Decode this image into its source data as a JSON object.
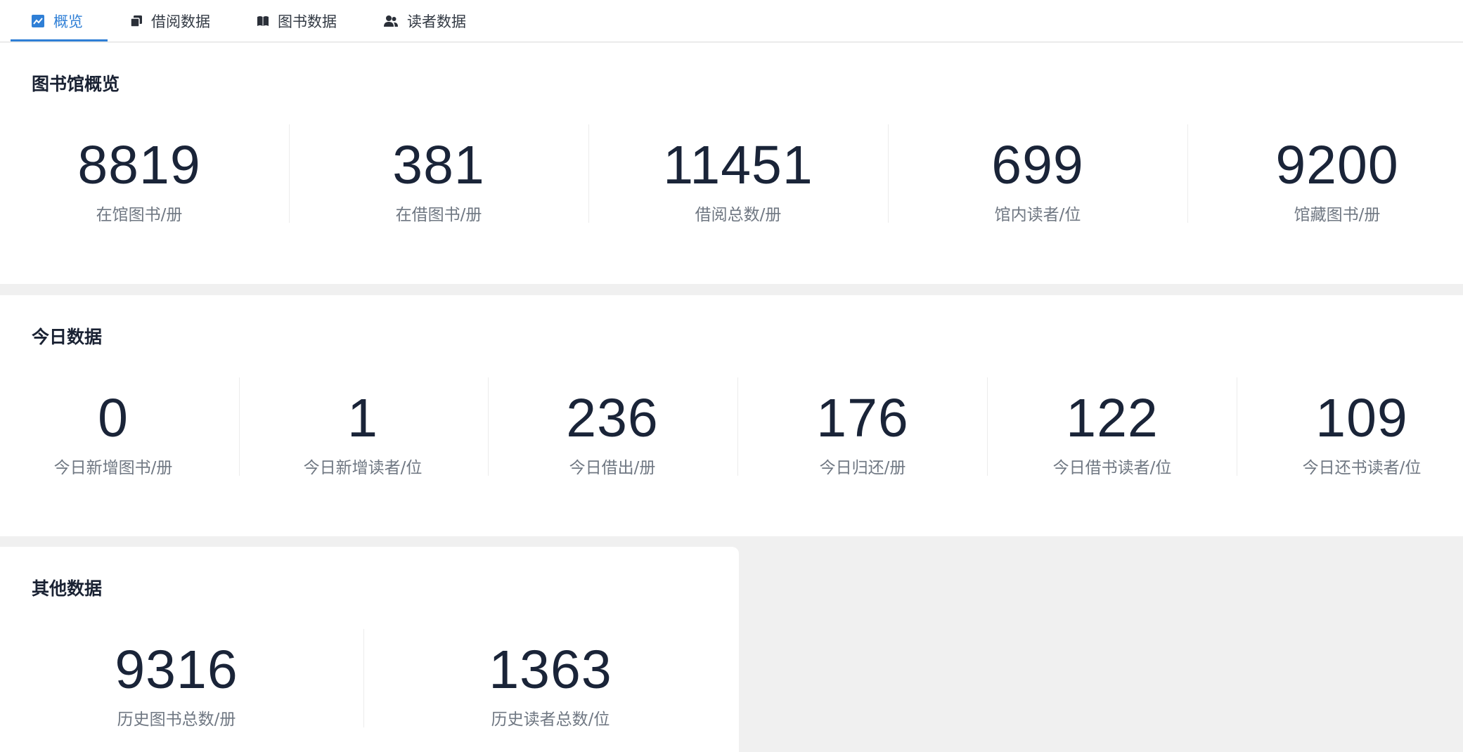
{
  "tabs": [
    {
      "label": "概览",
      "icon": "chart-icon",
      "active": true
    },
    {
      "label": "借阅数据",
      "icon": "copy-icon",
      "active": false
    },
    {
      "label": "图书数据",
      "icon": "book-icon",
      "active": false
    },
    {
      "label": "读者数据",
      "icon": "users-icon",
      "active": false
    }
  ],
  "overview": {
    "title": "图书馆概览",
    "stats": [
      {
        "value": "8819",
        "label": "在馆图书/册"
      },
      {
        "value": "381",
        "label": "在借图书/册"
      },
      {
        "value": "11451",
        "label": "借阅总数/册"
      },
      {
        "value": "699",
        "label": "馆内读者/位"
      },
      {
        "value": "9200",
        "label": "馆藏图书/册"
      }
    ]
  },
  "today": {
    "title": "今日数据",
    "stats": [
      {
        "value": "0",
        "label": "今日新增图书/册"
      },
      {
        "value": "1",
        "label": "今日新增读者/位"
      },
      {
        "value": "236",
        "label": "今日借出/册"
      },
      {
        "value": "176",
        "label": "今日归还/册"
      },
      {
        "value": "122",
        "label": "今日借书读者/位"
      },
      {
        "value": "109",
        "label": "今日还书读者/位"
      }
    ]
  },
  "other": {
    "title": "其他数据",
    "stats": [
      {
        "value": "9316",
        "label": "历史图书总数/册"
      },
      {
        "value": "1363",
        "label": "历史读者总数/位"
      }
    ]
  },
  "colors": {
    "accent": "#2f7fd6",
    "text": "#1a2438",
    "muted": "#6f7782",
    "background": "#f0f0f0"
  }
}
